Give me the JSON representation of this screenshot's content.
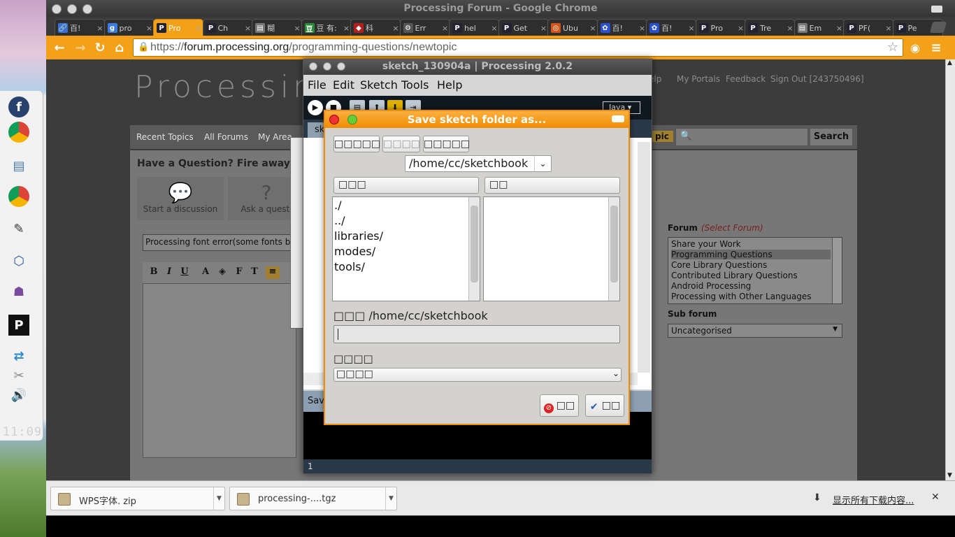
{
  "desktop": {
    "clock": "11:09"
  },
  "chrome": {
    "title": "Processing Forum - Google Chrome",
    "tabs": [
      {
        "label": "百!",
        "fav": "🔗",
        "color": "#3b6fd6"
      },
      {
        "label": "pro",
        "fav": "g",
        "color": "#3b7ae0"
      },
      {
        "label": "Pro",
        "fav": "P",
        "color": "#223",
        "active": true
      },
      {
        "label": "Ch",
        "fav": "P",
        "color": "#223"
      },
      {
        "label": "糊",
        "fav": "▤",
        "color": "#777"
      },
      {
        "label": "豆 有:",
        "fav": "豆",
        "color": "#2a8a3a"
      },
      {
        "label": "科",
        "fav": "◆",
        "color": "#b02020"
      },
      {
        "label": "Err",
        "fav": "⚙",
        "color": "#555"
      },
      {
        "label": "hel",
        "fav": "P",
        "color": "#223"
      },
      {
        "label": "Get",
        "fav": "P",
        "color": "#223"
      },
      {
        "label": "Ubu",
        "fav": "◎",
        "color": "#d2541a"
      },
      {
        "label": "百!",
        "fav": "✿",
        "color": "#2a4fd0"
      },
      {
        "label": "百!",
        "fav": "✿",
        "color": "#2a4fd0"
      },
      {
        "label": "Pro",
        "fav": "P",
        "color": "#223"
      },
      {
        "label": "Tre",
        "fav": "P",
        "color": "#223"
      },
      {
        "label": "Em",
        "fav": "▤",
        "color": "#777"
      },
      {
        "label": "PF(",
        "fav": "P",
        "color": "#223"
      },
      {
        "label": "Pe",
        "fav": "P",
        "color": "#223"
      }
    ],
    "url_scheme": "https://",
    "url_host": "forum.processing.org",
    "url_path": "/programming-questions/newtopic"
  },
  "forum": {
    "logo": "Processing F",
    "top_links": [
      "elp",
      "My Portals",
      "Feedback",
      "Sign Out [243750496]"
    ],
    "nav": [
      "Recent Topics",
      "All Forums",
      "My Area"
    ],
    "nav_right": "pic",
    "search_label": "Search",
    "question_title": "Have a Question? Fire away and",
    "choices": [
      "Start a discussion",
      "Ask a questi"
    ],
    "subject_value": "Processing font error(some fonts bee",
    "forum_label": "Forum",
    "select_forum": "(Select Forum)",
    "forum_options": [
      "Share your Work",
      "Programming Questions",
      "Core Library Questions",
      "Contributed Library Questions",
      "Android Processing",
      "Processing with Other Languages"
    ],
    "selected_forum": "Programming Questions",
    "subforum_label": "Sub forum",
    "subforum_value": "Uncategorised"
  },
  "downloads": {
    "items": [
      "WPS字体. zip",
      "processing-....tgz"
    ],
    "show_all": "显示所有下载内容..."
  },
  "ide": {
    "title": "sketch_130904a | Processing 2.0.2",
    "menu": [
      "File",
      "Edit",
      "Sketch",
      "Tools",
      "Help"
    ],
    "mode": "Java",
    "tab": "sk",
    "status": "Savi",
    "line": "1"
  },
  "dialog": {
    "title": "Save sketch folder as...",
    "nav_buttons": [
      "□□□□□",
      "□□□□",
      "□□□□□"
    ],
    "path": "/home/cc/sketchbook",
    "col_dirs": "□□□",
    "col_files": "□□",
    "dirs": [
      "./",
      "../",
      "libraries/",
      "modes/",
      "tools/"
    ],
    "folder_label": "□□□ /home/cc/sketchbook",
    "filename": "",
    "filter_label": "□□□□",
    "filter_value": "□□□□",
    "cancel": "□□",
    "ok": "□□"
  },
  "colors": {
    "chrome_accent": "#f4a11a",
    "dialog_accent": "#f08c00"
  }
}
